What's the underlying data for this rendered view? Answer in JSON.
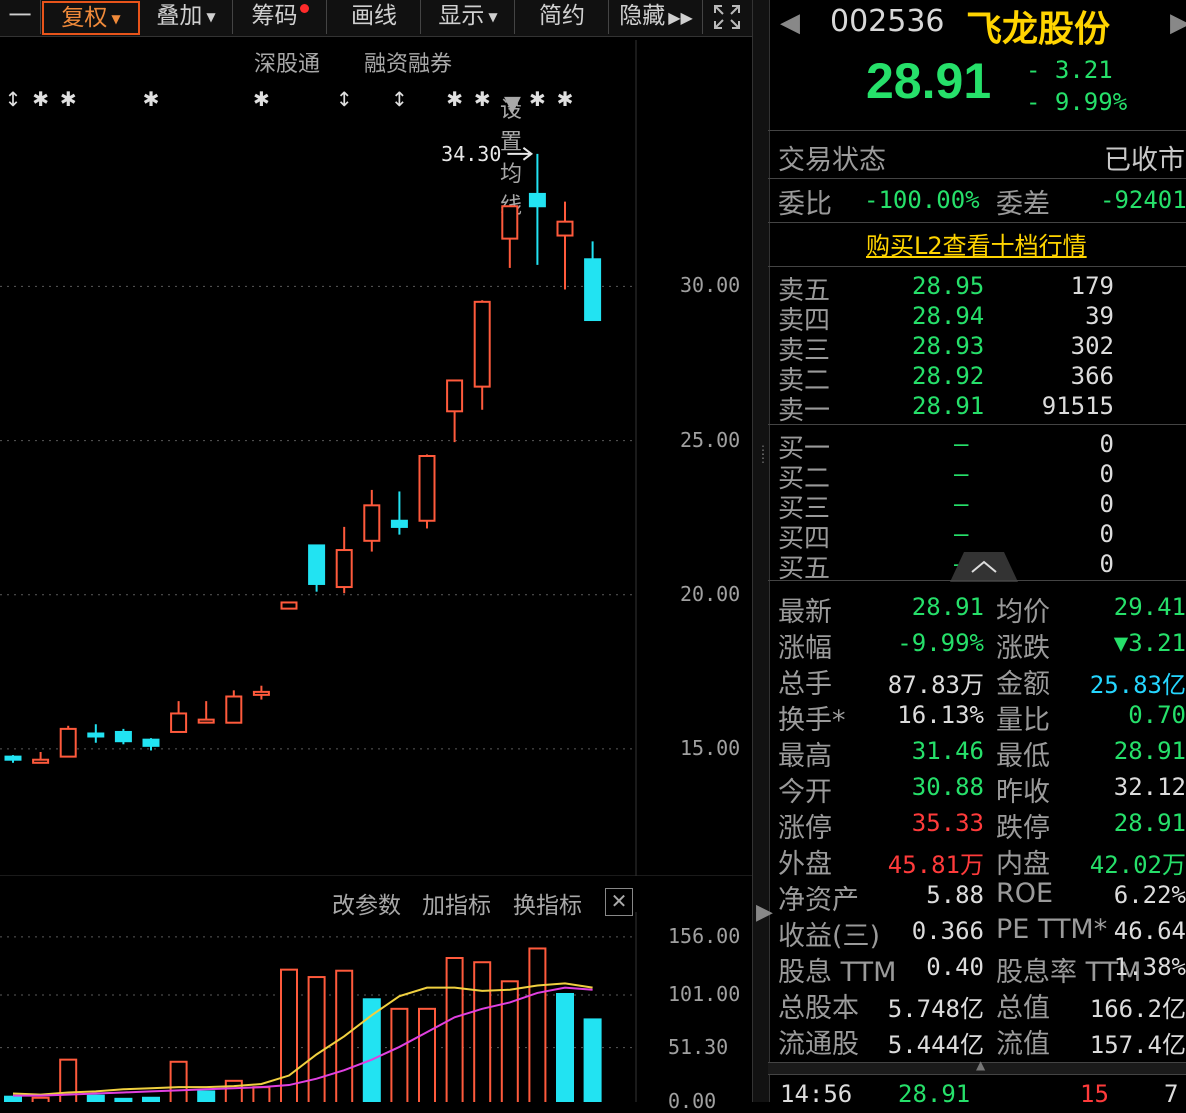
{
  "toolbar": {
    "dash": "一",
    "fuquan": "复权",
    "diejia": "叠加",
    "chouma": "筹码",
    "huaxian": "画线",
    "xianshi": "显示",
    "jianyue": "简约",
    "yincang": "隐藏",
    "expand_icon": "expand-icon"
  },
  "subbar": {
    "shengutong": "深股通",
    "rongzi": "融资融券",
    "junxian": "设置均线"
  },
  "kline": {
    "peak_label": "34.30",
    "axis": [
      "30.00",
      "25.00",
      "20.00",
      "15.00"
    ],
    "ylim": [
      12.5,
      36.5
    ],
    "candles": [
      {
        "o": 14.75,
        "c": 14.65,
        "h": 14.8,
        "l": 14.55,
        "u": false
      },
      {
        "o": 14.55,
        "c": 14.65,
        "h": 14.9,
        "l": 14.55,
        "u": true
      },
      {
        "o": 14.75,
        "c": 15.65,
        "h": 15.75,
        "l": 14.75,
        "u": true
      },
      {
        "o": 15.45,
        "c": 15.5,
        "h": 15.8,
        "l": 15.2,
        "u": false
      },
      {
        "o": 15.55,
        "c": 15.25,
        "h": 15.65,
        "l": 15.15,
        "u": false
      },
      {
        "o": 15.3,
        "c": 15.1,
        "h": 15.35,
        "l": 14.95,
        "u": false
      },
      {
        "o": 15.55,
        "c": 16.15,
        "h": 16.55,
        "l": 15.55,
        "u": true
      },
      {
        "o": 15.9,
        "c": 15.95,
        "h": 16.55,
        "l": 15.85,
        "u": true
      },
      {
        "o": 15.85,
        "c": 16.7,
        "h": 16.9,
        "l": 15.85,
        "u": true
      },
      {
        "o": 16.8,
        "c": 16.85,
        "h": 17.05,
        "l": 16.6,
        "u": true
      },
      {
        "o": 19.55,
        "c": 19.75,
        "h": 19.75,
        "l": 19.55,
        "u": true
      },
      {
        "o": 21.6,
        "c": 20.35,
        "h": 21.6,
        "l": 20.1,
        "u": false
      },
      {
        "o": 20.25,
        "c": 21.45,
        "h": 22.2,
        "l": 20.05,
        "u": true
      },
      {
        "o": 21.75,
        "c": 22.9,
        "h": 23.4,
        "l": 21.4,
        "u": true
      },
      {
        "o": 22.4,
        "c": 22.2,
        "h": 23.35,
        "l": 21.95,
        "u": false
      },
      {
        "o": 22.4,
        "c": 24.5,
        "h": 24.55,
        "l": 22.15,
        "u": true
      },
      {
        "o": 25.95,
        "c": 26.95,
        "h": 26.95,
        "l": 24.95,
        "u": true
      },
      {
        "o": 26.75,
        "c": 29.5,
        "h": 29.55,
        "l": 26.0,
        "u": true
      },
      {
        "o": 31.55,
        "c": 32.6,
        "h": 32.6,
        "l": 30.6,
        "u": true
      },
      {
        "o": 33.0,
        "c": 32.6,
        "h": 34.3,
        "l": 30.7,
        "u": false
      },
      {
        "o": 31.65,
        "c": 32.1,
        "h": 32.75,
        "l": 29.9,
        "u": true
      },
      {
        "o": 30.88,
        "c": 28.91,
        "h": 31.46,
        "l": 28.91,
        "u": false
      }
    ],
    "markers": [
      "↕",
      "✱",
      "✱",
      "✱",
      "✱",
      "↕",
      "↕",
      "✱",
      "✱",
      "✱",
      "✱"
    ]
  },
  "volume": {
    "btn_gaicanshu": "改参数",
    "btn_jiazhibiao": "加指标",
    "btn_huanzhibiao": "换指标",
    "close_icon": "close-icon",
    "axis": [
      "156.00",
      "101.00",
      "51.30",
      "0.00"
    ],
    "ymax": 170,
    "bars": [
      {
        "v": 5,
        "u": false
      },
      {
        "v": 4,
        "u": true
      },
      {
        "v": 40,
        "u": true
      },
      {
        "v": 6,
        "u": false
      },
      {
        "v": 3,
        "u": false
      },
      {
        "v": 4,
        "u": false
      },
      {
        "v": 38,
        "u": true
      },
      {
        "v": 10,
        "u": false
      },
      {
        "v": 20,
        "u": true
      },
      {
        "v": 14,
        "u": true
      },
      {
        "v": 125,
        "u": true
      },
      {
        "v": 118,
        "u": true
      },
      {
        "v": 124,
        "u": true
      },
      {
        "v": 97,
        "u": false
      },
      {
        "v": 88,
        "u": true
      },
      {
        "v": 88,
        "u": true
      },
      {
        "v": 136,
        "u": true
      },
      {
        "v": 132,
        "u": true
      },
      {
        "v": 114,
        "u": true
      },
      {
        "v": 145,
        "u": true
      },
      {
        "v": 102,
        "u": false
      },
      {
        "v": 78,
        "u": false
      }
    ],
    "ma5": [
      8,
      7,
      9,
      10,
      12,
      13,
      14,
      14,
      15,
      17,
      25,
      45,
      62,
      82,
      100,
      108,
      108,
      105,
      106,
      110,
      112,
      108
    ],
    "ma10": [
      6,
      6,
      7,
      8,
      9,
      10,
      11,
      12,
      13,
      14,
      16,
      22,
      30,
      40,
      52,
      66,
      80,
      88,
      94,
      103,
      108,
      106
    ]
  },
  "quote": {
    "code": "002536",
    "name": "飞龙股份",
    "price": "28.91",
    "change": "- 3.21",
    "change_pct": "- 9.99%",
    "status_label": "交易状态",
    "status_value": "已收市",
    "weibi_label": "委比",
    "weibi_value": "-100.00%",
    "weicha_label": "委差",
    "weicha_value": "-92401",
    "l2_link": "购买L2查看十档行情",
    "asks": [
      {
        "label": "卖五",
        "price": "28.95",
        "vol": "179"
      },
      {
        "label": "卖四",
        "price": "28.94",
        "vol": "39"
      },
      {
        "label": "卖三",
        "price": "28.93",
        "vol": "302"
      },
      {
        "label": "卖二",
        "price": "28.92",
        "vol": "366"
      },
      {
        "label": "卖一",
        "price": "28.91",
        "vol": "91515"
      }
    ],
    "bids": [
      {
        "label": "买一",
        "price": "—",
        "vol": "0"
      },
      {
        "label": "买二",
        "price": "—",
        "vol": "0"
      },
      {
        "label": "买三",
        "price": "—",
        "vol": "0"
      },
      {
        "label": "买四",
        "price": "—",
        "vol": "0"
      },
      {
        "label": "买五",
        "price": "—",
        "vol": "0"
      }
    ],
    "stats": [
      {
        "l1": "最新",
        "v1": "28.91",
        "c1": "g",
        "l2": "均价",
        "v2": "29.41",
        "c2": "g"
      },
      {
        "l1": "涨幅",
        "v1": "-9.99%",
        "c1": "g",
        "l2": "涨跌",
        "v2": "▼3.21",
        "c2": "g"
      },
      {
        "l1": "总手",
        "v1": "87.83万",
        "c1": "w",
        "l2": "金额",
        "v2": "25.83亿",
        "c2": "c"
      },
      {
        "l1": "换手*",
        "v1": "16.13%",
        "c1": "w",
        "l2": "量比",
        "v2": "0.70",
        "c2": "g"
      },
      {
        "l1": "最高",
        "v1": "31.46",
        "c1": "g",
        "l2": "最低",
        "v2": "28.91",
        "c2": "g"
      },
      {
        "l1": "今开",
        "v1": "30.88",
        "c1": "g",
        "l2": "昨收",
        "v2": "32.12",
        "c2": "w"
      },
      {
        "l1": "涨停",
        "v1": "35.33",
        "c1": "r",
        "l2": "跌停",
        "v2": "28.91",
        "c2": "g"
      },
      {
        "l1": "外盘",
        "v1": "45.81万",
        "c1": "r",
        "l2": "内盘",
        "v2": "42.02万",
        "c2": "g"
      },
      {
        "l1": "净资产",
        "v1": "5.88",
        "c1": "w",
        "l2": "ROE",
        "v2": "6.22%",
        "c2": "w"
      },
      {
        "l1": "收益(三)",
        "v1": "0.366",
        "c1": "w",
        "l2": "PE TTM*",
        "v2": "46.64",
        "c2": "w"
      },
      {
        "l1": "股息 TTM",
        "v1": "0.40",
        "c1": "w",
        "l2": "股息率 TTM",
        "v2": "1.38%",
        "c2": "w"
      },
      {
        "l1": "总股本",
        "v1": "5.748亿",
        "c1": "w",
        "l2": "总值",
        "v2": "166.2亿",
        "c2": "w"
      },
      {
        "l1": "流通股",
        "v1": "5.444亿",
        "c1": "w",
        "l2": "流值",
        "v2": "157.4亿",
        "c2": "w"
      }
    ],
    "tick": {
      "time": "14:56",
      "price": "28.91",
      "vol": "15",
      "num": "7"
    }
  },
  "colors": {
    "up": "#ff5a3c",
    "down": "#22e3f2",
    "ma5": "#f0d040",
    "ma10": "#e040e0",
    "grid": "#5a5a5a"
  }
}
